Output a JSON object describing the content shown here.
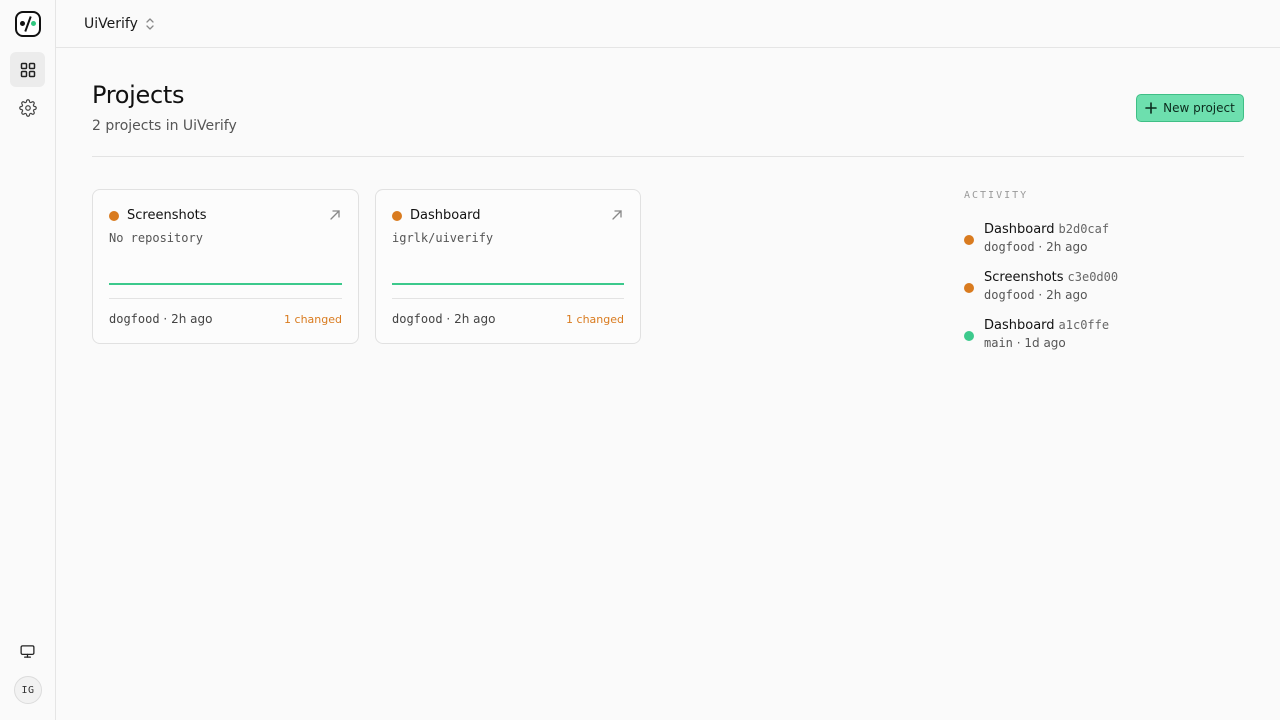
{
  "app": {
    "org_name": "UiVerify",
    "user_initials": "IG",
    "accent_color": "#3cc98c",
    "warning_color": "#d97b1f"
  },
  "sidebar": {
    "items": [
      {
        "name": "projects",
        "icon": "grid-icon",
        "active": true
      },
      {
        "name": "settings",
        "icon": "gear-icon",
        "active": false
      }
    ],
    "bottom": [
      {
        "name": "display",
        "icon": "monitor-icon"
      }
    ]
  },
  "page": {
    "title": "Projects",
    "subtitle": "2 projects in UiVerify",
    "new_button_label": "New project"
  },
  "projects": [
    {
      "name": "Screenshots",
      "repo": "No repository",
      "status_color": "#d97b1f",
      "branch": "dogfood",
      "sep": "·",
      "time": "2h ago",
      "changes": "1 changed"
    },
    {
      "name": "Dashboard",
      "repo": "igrlk/uiverify",
      "status_color": "#d97b1f",
      "branch": "dogfood",
      "sep": "·",
      "time": "2h ago",
      "changes": "1 changed"
    }
  ],
  "activity": {
    "title": "ACTIVITY",
    "items": [
      {
        "project": "Dashboard",
        "sha": "b2d0caf",
        "branch": "dogfood",
        "sep": "·",
        "time": "2h ago",
        "status_color": "#d97b1f"
      },
      {
        "project": "Screenshots",
        "sha": "c3e0d00",
        "branch": "dogfood",
        "sep": "·",
        "time": "2h ago",
        "status_color": "#d97b1f"
      },
      {
        "project": "Dashboard",
        "sha": "a1c0ffe",
        "branch": "main",
        "sep": "·",
        "time": "1d ago",
        "status_color": "#3cc98c"
      }
    ]
  }
}
